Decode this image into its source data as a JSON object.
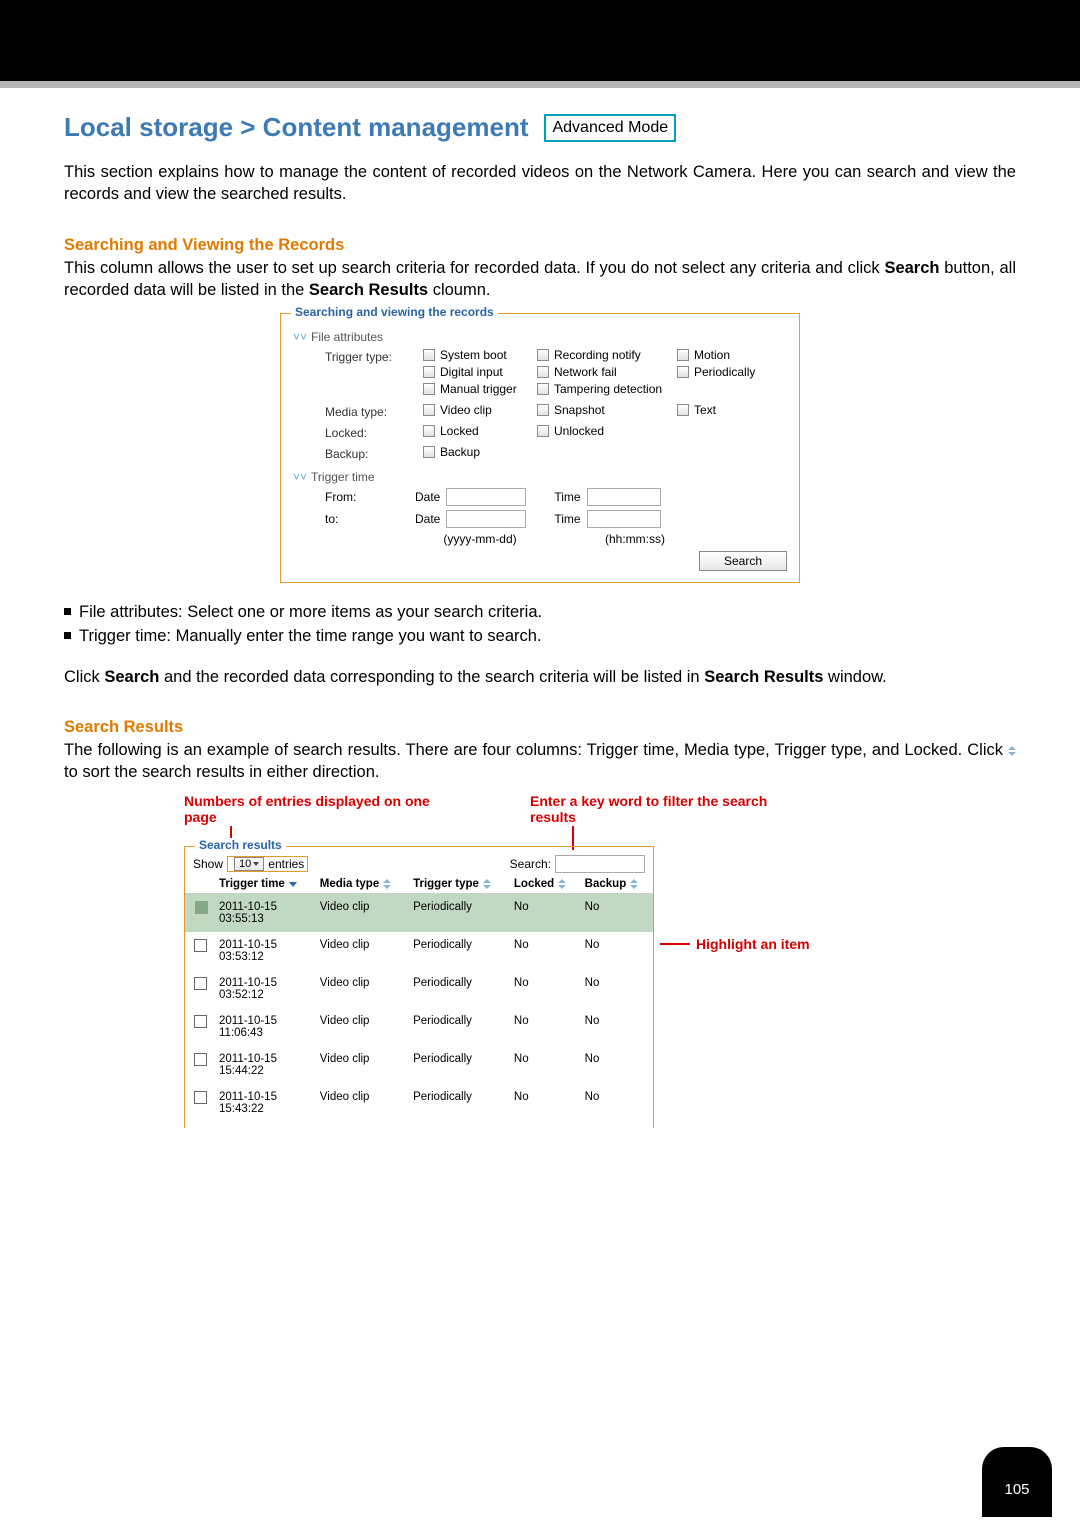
{
  "header": {
    "title": "Local storage > Content management",
    "mode_badge": "Advanced Mode"
  },
  "intro_paragraph": "This section explains how to manage the content of recorded videos on the Network Camera. Here you can search and view the records and view the searched results.",
  "section_search": {
    "heading": "Searching and Viewing the Records",
    "paragraph_lead": "This column allows the user to set up search criteria for recorded data. If you do not select any criteria and click ",
    "paragraph_bold1": "Search",
    "paragraph_mid": " button, all recorded data will be listed in the ",
    "paragraph_bold2": "Search Results",
    "paragraph_tail": " cloumn."
  },
  "search_panel": {
    "title": "Searching and viewing the records",
    "groups": {
      "file_attrs_label": "File attributes",
      "trigger_time_label": "Trigger time"
    },
    "rows": {
      "trigger_type": {
        "label": "Trigger type:",
        "options": [
          "System boot",
          "Recording notify",
          "Motion",
          "Digital input",
          "Network fail",
          "Periodically",
          "Manual trigger",
          "Tampering detection"
        ]
      },
      "media_type": {
        "label": "Media type:",
        "options": [
          "Video clip",
          "Snapshot",
          "Text"
        ]
      },
      "locked": {
        "label": "Locked:",
        "options": [
          "Locked",
          "Unlocked"
        ]
      },
      "backup": {
        "label": "Backup:",
        "options": [
          "Backup"
        ]
      },
      "from_label": "From:",
      "to_label": "to:",
      "date_label": "Date",
      "time_label": "Time",
      "date_hint": "(yyyy-mm-dd)",
      "time_hint": "(hh:mm:ss)",
      "search_btn": "Search"
    }
  },
  "bullets": {
    "b1": "File attributes: Select one or more items as your search criteria.",
    "b2": "Trigger time: Manually enter the time range you want to search."
  },
  "after_bullets": {
    "lead": "Click ",
    "bold1": "Search",
    "mid": " and the recorded data corresponding to the search criteria will be listed in ",
    "bold2": "Search Results",
    "tail": " window."
  },
  "section_results": {
    "heading": "Search Results",
    "paragraph_lead": "The following is an example of search results. There are four columns: Trigger time, Media type, Trigger type, and Locked. Click ",
    "paragraph_tail": " to sort the search results in either direction."
  },
  "annotations": {
    "entries": "Numbers of entries displayed on one page",
    "filter": "Enter a key word to filter the search results",
    "highlight": "Highlight an item"
  },
  "results_panel": {
    "title": "Search results",
    "show_label": "Show",
    "show_value": "10",
    "entries_label": "entries",
    "search_label": "Search:",
    "columns": [
      "Trigger time",
      "Media type",
      "Trigger type",
      "Locked",
      "Backup"
    ],
    "rows": [
      {
        "time": "2011-10-15 03:55:13",
        "media": "Video clip",
        "trigger": "Periodically",
        "locked": "No",
        "backup": "No",
        "selected": true
      },
      {
        "time": "2011-10-15 03:53:12",
        "media": "Video clip",
        "trigger": "Periodically",
        "locked": "No",
        "backup": "No",
        "selected": false
      },
      {
        "time": "2011-10-15 03:52:12",
        "media": "Video clip",
        "trigger": "Periodically",
        "locked": "No",
        "backup": "No",
        "selected": false
      },
      {
        "time": "2011-10-15 11:06:43",
        "media": "Video clip",
        "trigger": "Periodically",
        "locked": "No",
        "backup": "No",
        "selected": false
      },
      {
        "time": "2011-10-15 15:44:22",
        "media": "Video clip",
        "trigger": "Periodically",
        "locked": "No",
        "backup": "No",
        "selected": false
      },
      {
        "time": "2011-10-15 15:43:22",
        "media": "Video clip",
        "trigger": "Periodically",
        "locked": "No",
        "backup": "No",
        "selected": false
      }
    ]
  },
  "page_number": "105"
}
